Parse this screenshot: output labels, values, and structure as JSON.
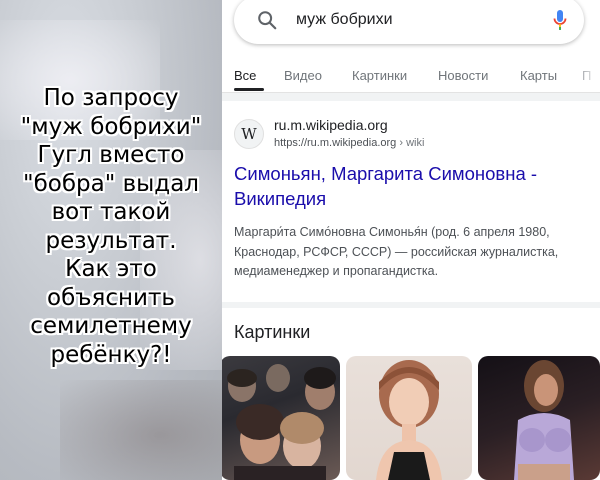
{
  "meme": {
    "caption": "По запросу\n\"муж бобрихи\"\nГугл вместо\n\"бобра\" выдал\nвот такой\nрезультат.\nКак это\nобъяснить\nсемилетнему\nребёнку?!"
  },
  "search": {
    "query": "муж бобрихи",
    "search_icon": "search-icon",
    "mic_icon": "mic-icon"
  },
  "tabs": [
    {
      "label": "Все",
      "active": true
    },
    {
      "label": "Видео",
      "active": false
    },
    {
      "label": "Картинки",
      "active": false
    },
    {
      "label": "Новости",
      "active": false
    },
    {
      "label": "Карты",
      "active": false
    },
    {
      "label": "П",
      "active": false
    }
  ],
  "result": {
    "favicon_letter": "W",
    "site_name": "ru.m.wikipedia.org",
    "url": "https://ru.m.wikipedia.org",
    "url_crumb": "› wiki",
    "title": "Симоньян, Маргарита Симоновна - Википедия",
    "snippet": "Маргари́та Симо́новна Симонья́н (род. 6 апреля 1980, Краснодар, РСФСР, СССР) — российская журналистка, медиаменеджер и пропагандистка."
  },
  "images_section": {
    "heading": "Картинки"
  },
  "colors": {
    "link": "#1a0dab",
    "text": "#202124",
    "muted": "#70757a"
  }
}
